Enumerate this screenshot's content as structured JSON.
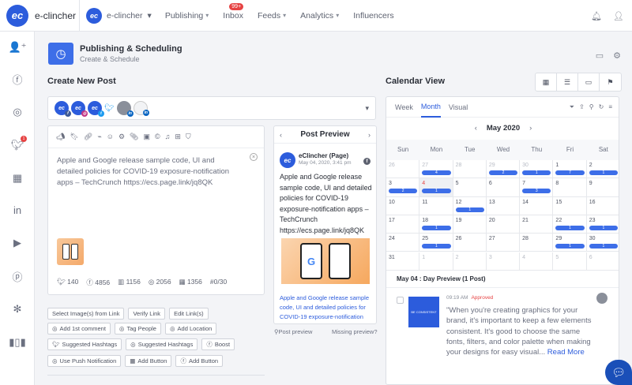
{
  "topbar": {
    "brand_logo": "ec",
    "brand_name": "e-clincher",
    "account_logo": "ec",
    "account_name": "e-clincher",
    "nav": [
      {
        "label": "Publishing",
        "dropdown": true
      },
      {
        "label": "Inbox",
        "badge": "99+"
      },
      {
        "label": "Feeds",
        "dropdown": true
      },
      {
        "label": "Analytics",
        "dropdown": true
      },
      {
        "label": "Influencers"
      }
    ],
    "icons": [
      "bell-icon",
      "user-icon"
    ]
  },
  "sidebar": {
    "icons": [
      "add-user-icon",
      "facebook-icon",
      "instagram-icon",
      "twitter-icon",
      "store-icon",
      "linkedin-icon",
      "youtube-icon",
      "pinterest-icon",
      "yelp-icon",
      "analytics-icon"
    ],
    "twitter_badge": "1"
  },
  "header": {
    "title": "Publishing & Scheduling",
    "subtitle": "Create & Schedule"
  },
  "create": {
    "section_title": "Create New Post",
    "post_text": "Apple and Google release sample code, UI and detailed policies for COVID-19 exposure-notification apps – TechCrunch https://ecs.page.link/jq8QK",
    "counts": {
      "twitter": "140",
      "facebook": "4856",
      "linkedin": "1156",
      "instagram": "2056",
      "other": "1356",
      "hash": "#0/30"
    },
    "buttons_row1": [
      "Select Image(s) from Link",
      "Verify Link",
      "Edit Link(s)"
    ],
    "buttons_row2": [
      "Add 1st comment",
      "Tag People",
      "Add Location"
    ],
    "buttons_row3": [
      "Suggested Hashtags",
      "Suggested Hashtags",
      "Boost"
    ],
    "buttons_row4": [
      "Use Push Notification",
      "Add Button",
      "Add Button"
    ]
  },
  "preview": {
    "title": "Post Preview",
    "page_name": "eClincher (Page)",
    "date": "May 04, 2020, 3:41 pm",
    "text": "Apple and Google release sample code, UI and detailed policies for COVID-19 exposure-notification apps – TechCrunch https://ecs.page.link/jq8QK",
    "link_title": "Apple and Google release sample code, UI and detailed policies for COVID-19 exposure-notification",
    "footer_left": "Post preview",
    "footer_right": "Missing preview?"
  },
  "calendar": {
    "section_title": "Calendar View",
    "tabs": [
      "Week",
      "Month",
      "Visual"
    ],
    "active_tab": "Month",
    "month_label": "May 2020",
    "weekdays": [
      "Sun",
      "Mon",
      "Tue",
      "Wed",
      "Thu",
      "Fri",
      "Sat"
    ],
    "weeks": [
      [
        {
          "d": "26",
          "dim": true
        },
        {
          "d": "27",
          "dim": true,
          "pill": "4"
        },
        {
          "d": "28",
          "dim": true
        },
        {
          "d": "29",
          "dim": true,
          "pill": "2"
        },
        {
          "d": "30",
          "dim": true,
          "pill": "1"
        },
        {
          "d": "1",
          "pill": "7"
        },
        {
          "d": "2",
          "pill": "1"
        }
      ],
      [
        {
          "d": "3",
          "pill": "2"
        },
        {
          "d": "4",
          "today": true,
          "pill": "1"
        },
        {
          "d": "5"
        },
        {
          "d": "6"
        },
        {
          "d": "7",
          "pill": "3"
        },
        {
          "d": "8"
        },
        {
          "d": "9"
        }
      ],
      [
        {
          "d": "10"
        },
        {
          "d": "11"
        },
        {
          "d": "12",
          "pill": "1"
        },
        {
          "d": "13"
        },
        {
          "d": "14"
        },
        {
          "d": "15"
        },
        {
          "d": "16"
        }
      ],
      [
        {
          "d": "17"
        },
        {
          "d": "18",
          "pill": "1"
        },
        {
          "d": "19"
        },
        {
          "d": "20"
        },
        {
          "d": "21"
        },
        {
          "d": "22",
          "pill": "1"
        },
        {
          "d": "23",
          "pill": "1"
        }
      ],
      [
        {
          "d": "24"
        },
        {
          "d": "25",
          "pill": "1"
        },
        {
          "d": "26"
        },
        {
          "d": "27"
        },
        {
          "d": "28"
        },
        {
          "d": "29",
          "pill": "1"
        },
        {
          "d": "30",
          "pill": "1"
        }
      ],
      [
        {
          "d": "31"
        },
        {
          "d": "1",
          "dim": true
        },
        {
          "d": "2",
          "dim": true
        },
        {
          "d": "3",
          "dim": true
        },
        {
          "d": "4",
          "dim": true
        },
        {
          "d": "5",
          "dim": true
        },
        {
          "d": "6",
          "dim": true
        }
      ]
    ],
    "day_preview_title": "May 04 : Day Preview (1 Post)",
    "item": {
      "time": "09:19 AM",
      "status": "Approved",
      "card_text": "BE CONSISTENT",
      "text": "\"When you're creating graphics for your brand, it's important to keep a few elements consistent. It's good to choose the same fonts, filters, and color palette when making your designs for easy visual...",
      "read_more": "Read More"
    }
  },
  "colors": {
    "accent": "#2c5cdc",
    "pill": "#3d6ee8",
    "badge": "#e64343"
  }
}
